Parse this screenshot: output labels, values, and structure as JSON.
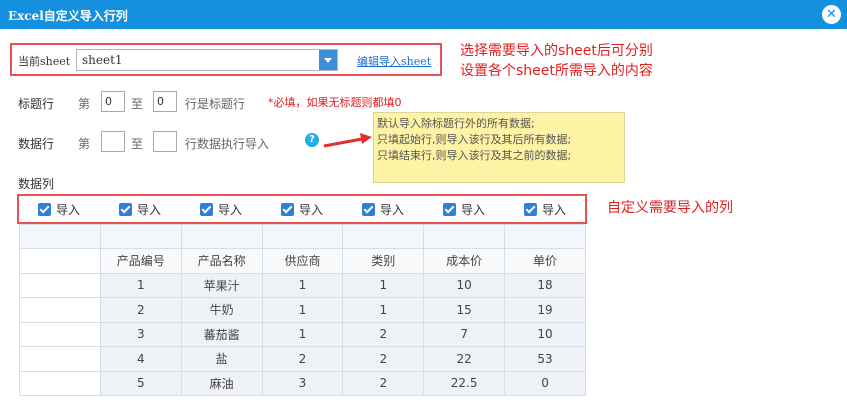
{
  "window": {
    "title": "Excel自定义导入行列",
    "close_glyph": "✕"
  },
  "sheet": {
    "label": "当前sheet",
    "selected": "sheet1",
    "edit_link": "编辑导入sheet"
  },
  "annotations": {
    "sheet_note_line1": "选择需要导入的sheet后可分别",
    "sheet_note_line2": "设置各个sheet所需导入的内容",
    "column_note": "自定义需要导入的列"
  },
  "title_row": {
    "label": "标题行",
    "prefix": "第",
    "start": "0",
    "to": "至",
    "end": "0",
    "suffix": "行是标题行",
    "required_note": "*必填，如果无标题则都填0"
  },
  "data_row": {
    "label": "数据行",
    "prefix": "第",
    "start": "",
    "to": "至",
    "end": "",
    "suffix": "行数据执行导入",
    "help_glyph": "?"
  },
  "tooltip": {
    "line1": "默认导入除标题行外的所有数据;",
    "line2": "只填起始行,则导入该行及其后所有数据;",
    "line3": "只填结束行,则导入该行及其之前的数据;"
  },
  "data_columns": {
    "label": "数据列",
    "checkboxes": [
      {
        "label": "导入",
        "checked": true
      },
      {
        "label": "导入",
        "checked": true
      },
      {
        "label": "导入",
        "checked": true
      },
      {
        "label": "导入",
        "checked": true
      },
      {
        "label": "导入",
        "checked": true
      },
      {
        "label": "导入",
        "checked": true
      },
      {
        "label": "导入",
        "checked": true
      }
    ]
  },
  "table": {
    "headers": [
      "产品编号",
      "产品名称",
      "供应商",
      "类别",
      "成本价",
      "单价"
    ],
    "rows": [
      [
        "1",
        "苹果汁",
        "1",
        "1",
        "10",
        "18"
      ],
      [
        "2",
        "牛奶",
        "1",
        "1",
        "15",
        "19"
      ],
      [
        "3",
        "蕃茄酱",
        "1",
        "2",
        "7",
        "10"
      ],
      [
        "4",
        "盐",
        "2",
        "2",
        "22",
        "53"
      ],
      [
        "5",
        "麻油",
        "3",
        "2",
        "22.5",
        "0"
      ]
    ]
  },
  "colors": {
    "titlebar": "#1590df",
    "highlight_box": "#e85252",
    "note_text": "#e02020",
    "tooltip_bg": "#fdf3a4",
    "checkbox": "#2f7fd6"
  }
}
